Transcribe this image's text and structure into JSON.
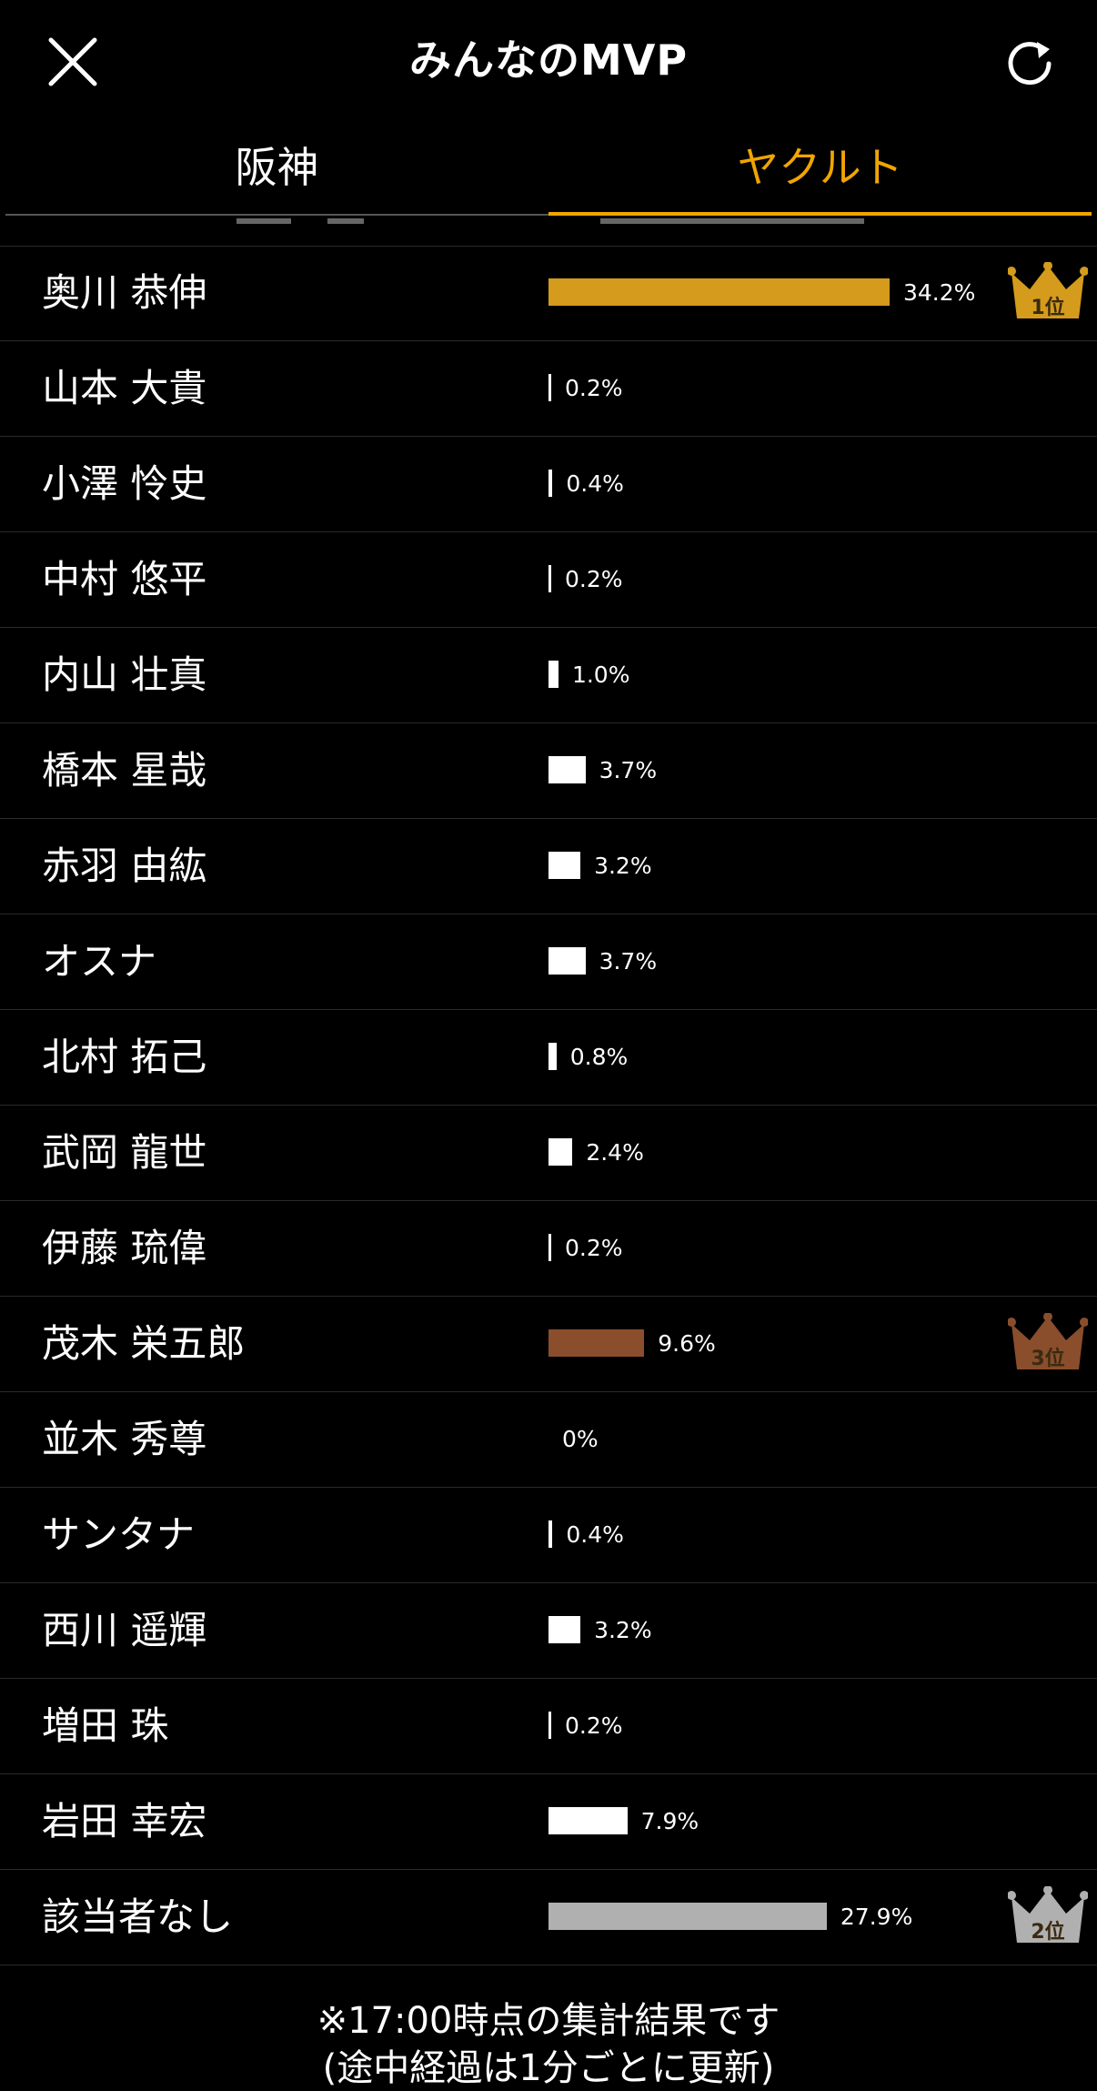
{
  "header": {
    "title": "みんなのMVP",
    "close_icon": "close-icon",
    "refresh_icon": "refresh-icon"
  },
  "tabs": [
    {
      "label": "阪神",
      "active": false
    },
    {
      "label": "ヤクルト",
      "active": true
    }
  ],
  "colors": {
    "accent": "#f0a500",
    "gold": "#d49b1c",
    "bronze": "#8a4e2c",
    "silver": "#b0b0b0",
    "bar_default": "#ffffff"
  },
  "players": [
    {
      "name": "奥川 恭伸",
      "pct_label": "34.2%",
      "value": 34.2,
      "rank": "1位",
      "color": "#d49b1c"
    },
    {
      "name": "山本 大貴",
      "pct_label": "0.2%",
      "value": 0.2
    },
    {
      "name": "小澤 怜史",
      "pct_label": "0.4%",
      "value": 0.4
    },
    {
      "name": "中村 悠平",
      "pct_label": "0.2%",
      "value": 0.2
    },
    {
      "name": "内山 壮真",
      "pct_label": "1.0%",
      "value": 1.0
    },
    {
      "name": "橋本 星哉",
      "pct_label": "3.7%",
      "value": 3.7
    },
    {
      "name": "赤羽 由紘",
      "pct_label": "3.2%",
      "value": 3.2
    },
    {
      "name": "オスナ",
      "pct_label": "3.7%",
      "value": 3.7
    },
    {
      "name": "北村 拓己",
      "pct_label": "0.8%",
      "value": 0.8
    },
    {
      "name": "武岡 龍世",
      "pct_label": "2.4%",
      "value": 2.4
    },
    {
      "name": "伊藤 琉偉",
      "pct_label": "0.2%",
      "value": 0.2
    },
    {
      "name": "茂木 栄五郎",
      "pct_label": "9.6%",
      "value": 9.6,
      "rank": "3位",
      "color": "#8a4e2c"
    },
    {
      "name": "並木 秀尊",
      "pct_label": "0%",
      "value": 0
    },
    {
      "name": "サンタナ",
      "pct_label": "0.4%",
      "value": 0.4
    },
    {
      "name": "西川 遥輝",
      "pct_label": "3.2%",
      "value": 3.2
    },
    {
      "name": "増田 珠",
      "pct_label": "0.2%",
      "value": 0.2
    },
    {
      "name": "岩田 幸宏",
      "pct_label": "7.9%",
      "value": 7.9
    },
    {
      "name": "該当者なし",
      "pct_label": "27.9%",
      "value": 27.9,
      "rank": "2位",
      "color": "#b0b0b0"
    }
  ],
  "footer": {
    "line1": "※17:00時点の集計結果です",
    "line2": "(途中経過は1分ごとに更新)"
  }
}
